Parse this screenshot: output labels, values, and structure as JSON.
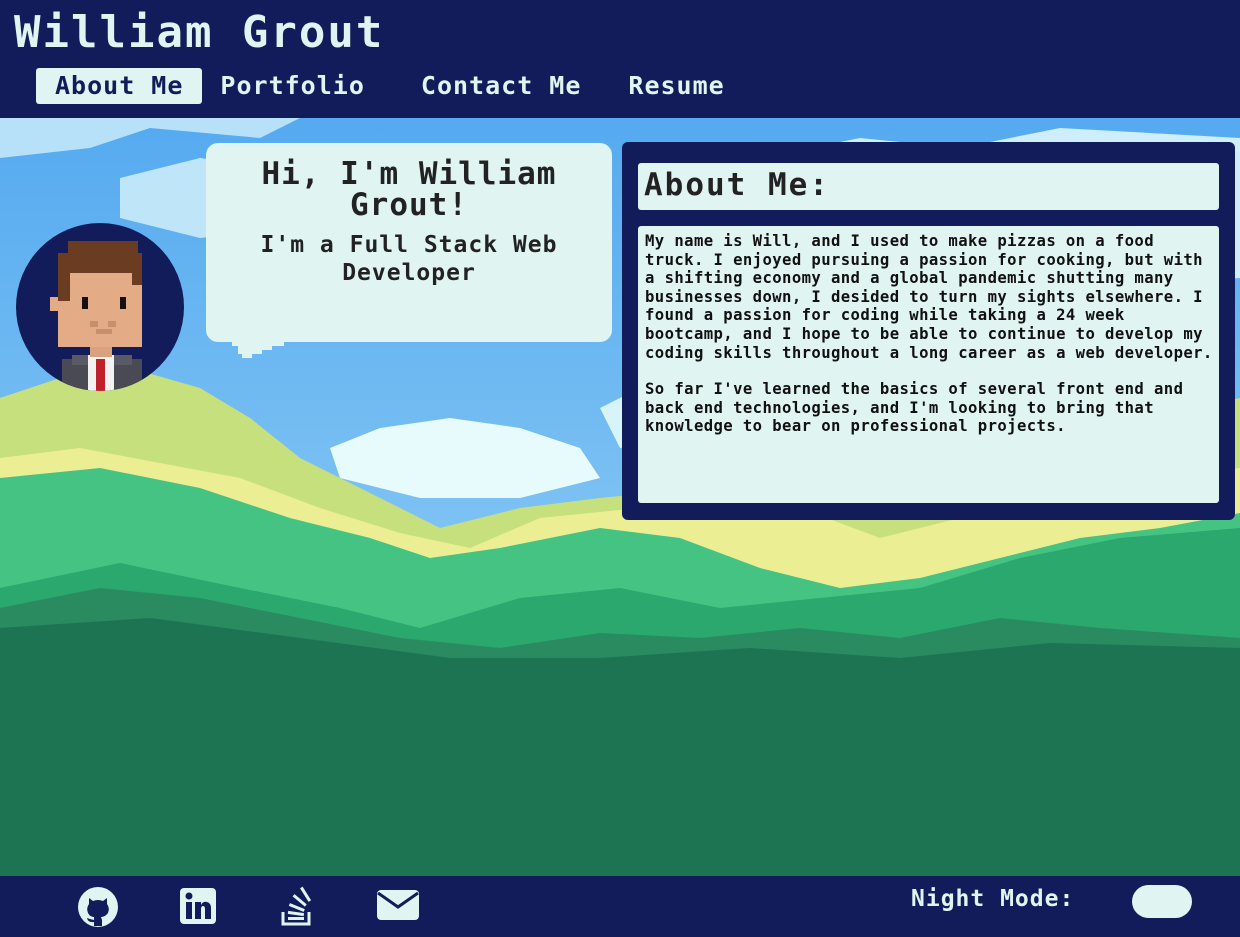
{
  "header": {
    "title": "William Grout",
    "nav": [
      {
        "label": "About Me",
        "active": true
      },
      {
        "label": "Portfolio",
        "active": false
      },
      {
        "label": "Contact Me",
        "active": false
      },
      {
        "label": "Resume",
        "active": false
      }
    ]
  },
  "intro": {
    "greeting": "Hi, I'm William Grout!",
    "role": "I'm a Full Stack Web Developer",
    "avatar_icon": "pixel-avatar"
  },
  "about": {
    "heading": "About Me:",
    "paragraphs": [
      "My name is Will, and I used to make pizzas on a food truck. I enjoyed pursuing a passion for cooking, but with a shifting economy and a global pandemic shutting many businesses down, I desided to turn my sights elsewhere. I found a passion for coding while taking a 24 week bootcamp, and I hope to be able to continue to develop my coding skills throughout a long career as a web developer.",
      "So far I've learned the basics of several front end and back end technologies, and I'm looking to bring that knowledge to bear on professional projects."
    ]
  },
  "footer": {
    "social_icons": [
      "github-icon",
      "linkedin-icon",
      "stackoverflow-icon",
      "email-icon"
    ],
    "night_mode_label": "Night Mode:"
  },
  "colors": {
    "navy": "#121c5a",
    "panel_text_bg": "#e0f4f2",
    "grass_dark": "#1d7453"
  }
}
